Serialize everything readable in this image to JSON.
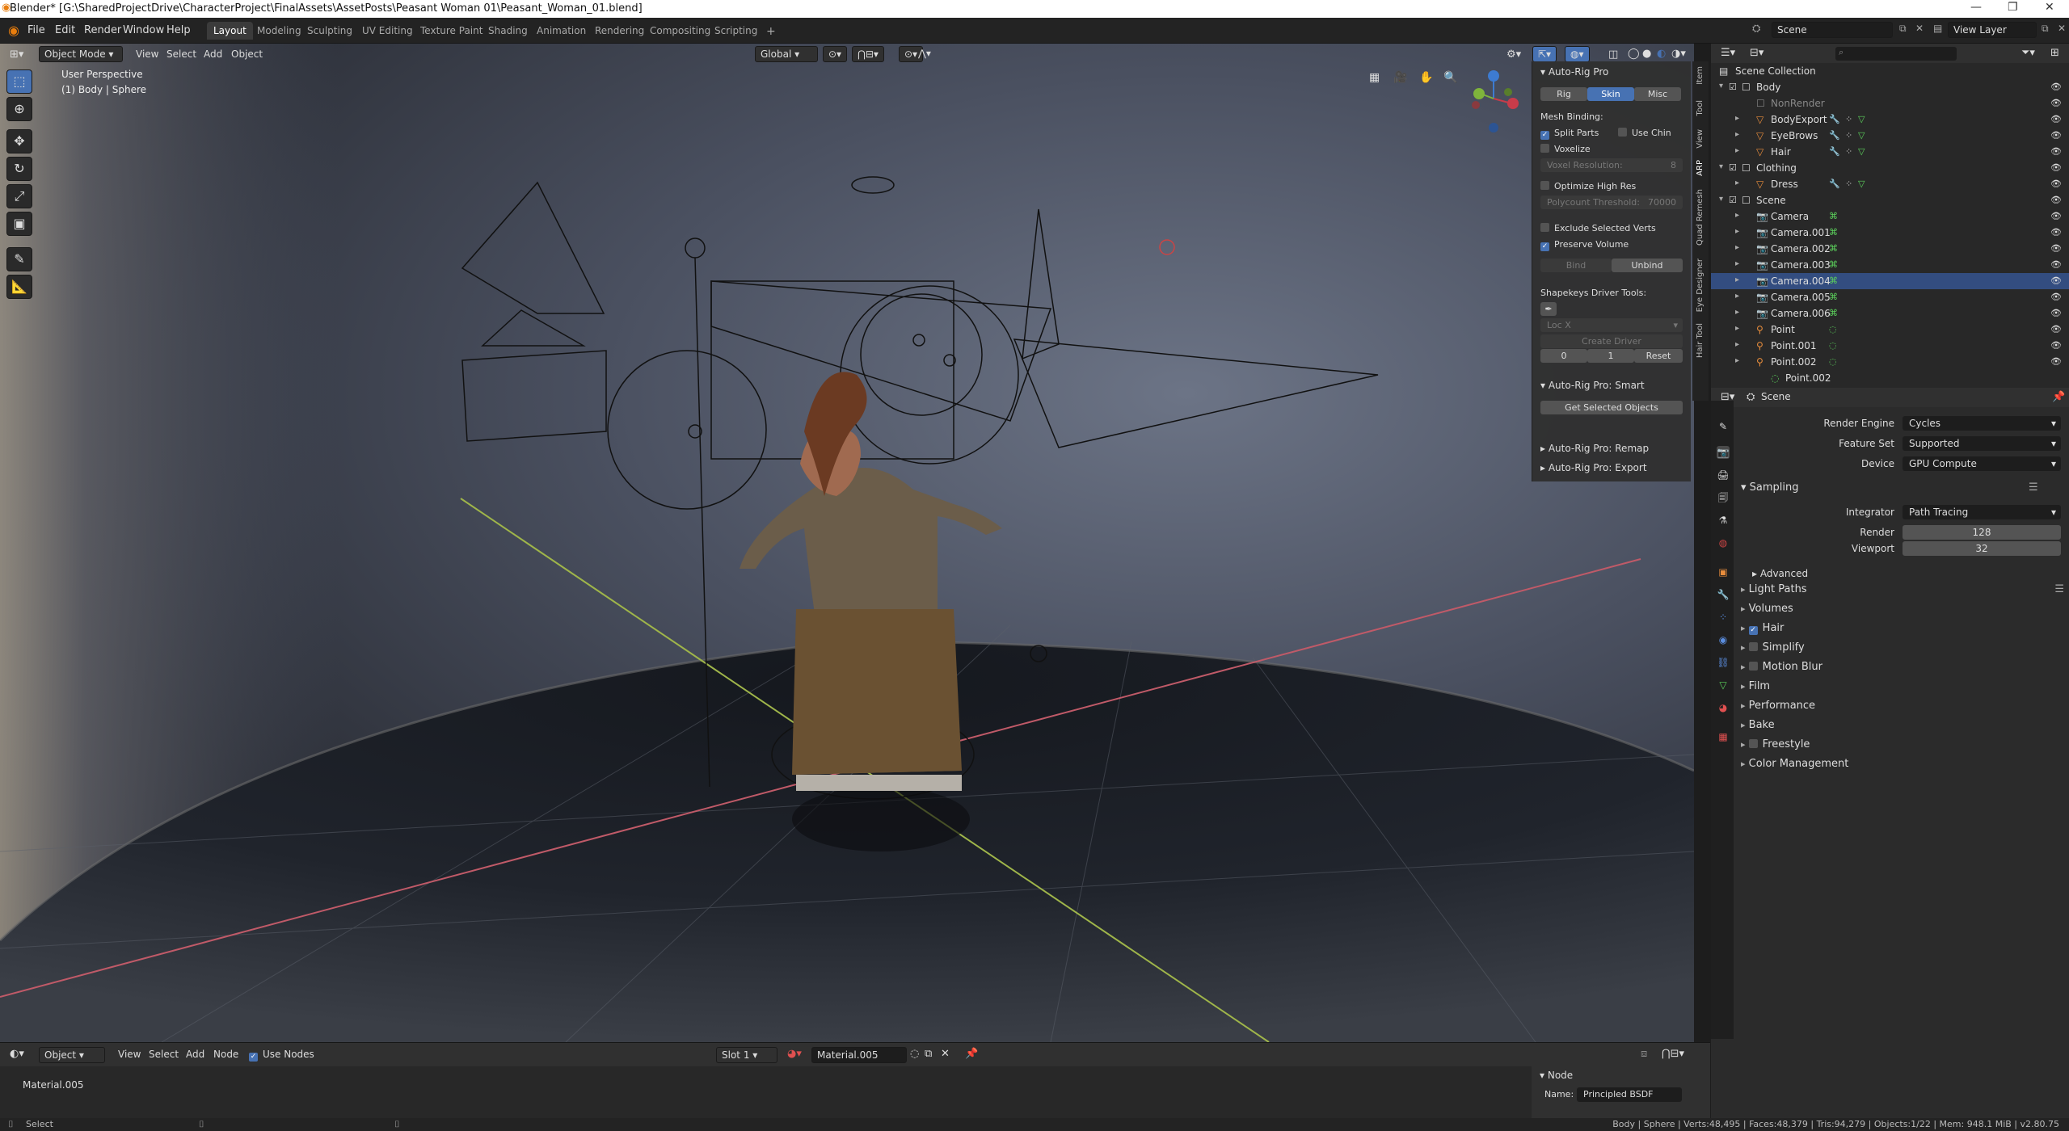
{
  "window": {
    "title": "Blender* [G:\\SharedProjectDrive\\CharacterProject\\FinalAssets\\AssetPosts\\Peasant Woman 01\\Peasant_Woman_01.blend]"
  },
  "menu": [
    "File",
    "Edit",
    "Render",
    "Window",
    "Help"
  ],
  "workspaces": [
    "Layout",
    "Modeling",
    "Sculpting",
    "UV Editing",
    "Texture Paint",
    "Shading",
    "Animation",
    "Rendering",
    "Compositing",
    "Scripting",
    "+"
  ],
  "scene": {
    "name": "Scene",
    "view_layer": "View Layer"
  },
  "viewport": {
    "mode": "Object Mode",
    "menus": [
      "View",
      "Select",
      "Add",
      "Object"
    ],
    "orientation": "Global",
    "info_line1": "User Perspective",
    "info_line2": "(1) Body | Sphere"
  },
  "npanel": {
    "title": "Auto-Rig Pro",
    "tabs": [
      "Rig",
      "Skin",
      "Misc"
    ],
    "mesh_binding": "Mesh Binding:",
    "split_parts": "Split Parts",
    "use_chin": "Use Chin",
    "voxelize": "Voxelize",
    "voxel_res_label": "Voxel Resolution:",
    "voxel_res": "8",
    "optimize": "Optimize High Res",
    "poly_label": "Polycount Threshold:",
    "poly": "70000",
    "exclude": "Exclude Selected Verts",
    "preserve": "Preserve Volume",
    "bind": "Bind",
    "unbind": "Unbind",
    "shapekeys": "Shapekeys Driver Tools:",
    "loc": "Loc X",
    "create_driver": "Create Driver",
    "v0": "0",
    "v1": "1",
    "reset": "Reset",
    "smart": "Auto-Rig Pro: Smart",
    "get_selected": "Get Selected Objects",
    "remap": "Auto-Rig Pro: Remap",
    "export": "Auto-Rig Pro: Export",
    "side_tabs": [
      "Item",
      "Tool",
      "View",
      "ARP",
      "Quad Remesh",
      "Eye Designer",
      "Hair Tool"
    ]
  },
  "outliner": {
    "root": "Scene Collection",
    "rows": [
      {
        "indent": 1,
        "name": "Body",
        "type": "collection"
      },
      {
        "indent": 2,
        "name": "NonRender",
        "type": "collection-dim"
      },
      {
        "indent": 2,
        "name": "BodyExport",
        "type": "mesh"
      },
      {
        "indent": 2,
        "name": "EyeBrows",
        "type": "mesh"
      },
      {
        "indent": 2,
        "name": "Hair",
        "type": "mesh"
      },
      {
        "indent": 1,
        "name": "Clothing",
        "type": "collection"
      },
      {
        "indent": 2,
        "name": "Dress",
        "type": "mesh"
      },
      {
        "indent": 1,
        "name": "Scene",
        "type": "collection"
      },
      {
        "indent": 2,
        "name": "Camera",
        "type": "camera"
      },
      {
        "indent": 2,
        "name": "Camera.001",
        "type": "camera"
      },
      {
        "indent": 2,
        "name": "Camera.002",
        "type": "camera"
      },
      {
        "indent": 2,
        "name": "Camera.003",
        "type": "camera"
      },
      {
        "indent": 2,
        "name": "Camera.004",
        "type": "camera",
        "selected": true
      },
      {
        "indent": 2,
        "name": "Camera.005",
        "type": "camera"
      },
      {
        "indent": 2,
        "name": "Camera.006",
        "type": "camera"
      },
      {
        "indent": 2,
        "name": "Point",
        "type": "light"
      },
      {
        "indent": 2,
        "name": "Point.001",
        "type": "light"
      },
      {
        "indent": 2,
        "name": "Point.002",
        "type": "light"
      },
      {
        "indent": 3,
        "name": "Point.002",
        "type": "lightdata"
      }
    ]
  },
  "properties": {
    "breadcrumb": "Scene",
    "render_engine_label": "Render Engine",
    "render_engine": "Cycles",
    "feature_set_label": "Feature Set",
    "feature_set": "Supported",
    "device_label": "Device",
    "device": "GPU Compute",
    "sampling": "Sampling",
    "integrator_label": "Integrator",
    "integrator": "Path Tracing",
    "render_label": "Render",
    "render": "128",
    "viewport_label": "Viewport",
    "viewport": "32",
    "advanced": "Advanced",
    "sections": [
      {
        "label": "Light Paths",
        "checkbox": false,
        "list": true
      },
      {
        "label": "Volumes",
        "checkbox": false
      },
      {
        "label": "Hair",
        "checkbox": true,
        "checked": true
      },
      {
        "label": "Simplify",
        "checkbox": true,
        "checked": false
      },
      {
        "label": "Motion Blur",
        "checkbox": true,
        "checked": false
      },
      {
        "label": "Film",
        "checkbox": false
      },
      {
        "label": "Performance",
        "checkbox": false
      },
      {
        "label": "Bake",
        "checkbox": false
      },
      {
        "label": "Freestyle",
        "checkbox": true,
        "checked": false
      },
      {
        "label": "Color Management",
        "checkbox": false
      }
    ]
  },
  "node_editor": {
    "object": "Object",
    "menus": [
      "View",
      "Select",
      "Add",
      "Node"
    ],
    "use_nodes": "Use Nodes",
    "slot": "Slot 1",
    "material": "Material.005",
    "breadcrumb": "Material.005",
    "panel_title": "Node",
    "name_label": "Name:",
    "name_value": "Principled BSDF"
  },
  "status": {
    "left": "Select",
    "right": "Body | Sphere | Verts:48,495 | Faces:48,379 | Tris:94,279 | Objects:1/22 | Mem: 948.1 MiB | v2.80.75"
  }
}
